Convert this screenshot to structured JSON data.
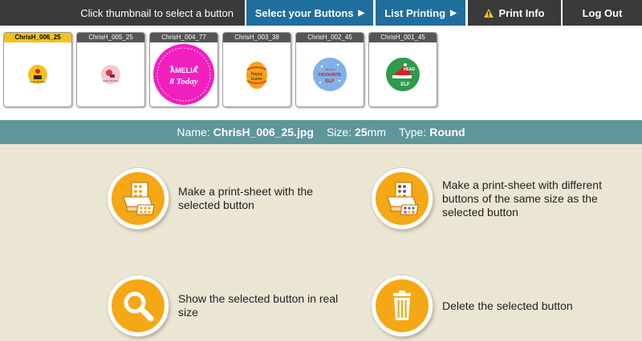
{
  "topbar": {
    "hint": "Click thumbnail to select a button",
    "tabs": {
      "select": "Select your Buttons",
      "list": "List Printing",
      "info": "Print Info",
      "logout": "Log Out"
    }
  },
  "thumbnails": [
    {
      "label": "ChrisH_006_25",
      "selected": true,
      "art_text": "Happy Birthday"
    },
    {
      "label": "ChrisH_005_25",
      "selected": false,
      "art_text": "Happy Birthday"
    },
    {
      "label": "ChrisH_004_77",
      "selected": false,
      "art_text": "AMELIA",
      "art_text2": "8 Today"
    },
    {
      "label": "ChrisH_003_38",
      "selected": false,
      "art_text": "Happy",
      "art_text2": "Easter"
    },
    {
      "label": "ChrisH_002_45",
      "selected": false,
      "art_text": "Santa's",
      "art_text2": "FAVOURITE",
      "art_text3": "ELF"
    },
    {
      "label": "ChrisH_001_45",
      "selected": false,
      "art_text": "HEAD",
      "art_text2": "ELF"
    }
  ],
  "info": {
    "name_label": "Name:",
    "name_value": "ChrisH_006_25.jpg",
    "size_label": "Size:",
    "size_value": "25",
    "size_unit": "mm",
    "type_label": "Type:",
    "type_value": "Round"
  },
  "actions": {
    "print_selected": "Make a print-sheet with the selected button",
    "print_different": "Make a print-sheet with different buttons of the same size as the selected button",
    "real_size": "Show the selected button in real size",
    "delete": "Delete the selected button"
  },
  "colors": {
    "nav_dark": "#3a3a3a",
    "nav_blue": "#1f6e9c",
    "selected_label": "#f2c21b",
    "info_bar": "#5f9699",
    "panel_bg": "#ebe6d4",
    "action_orange": "#f5a815"
  }
}
